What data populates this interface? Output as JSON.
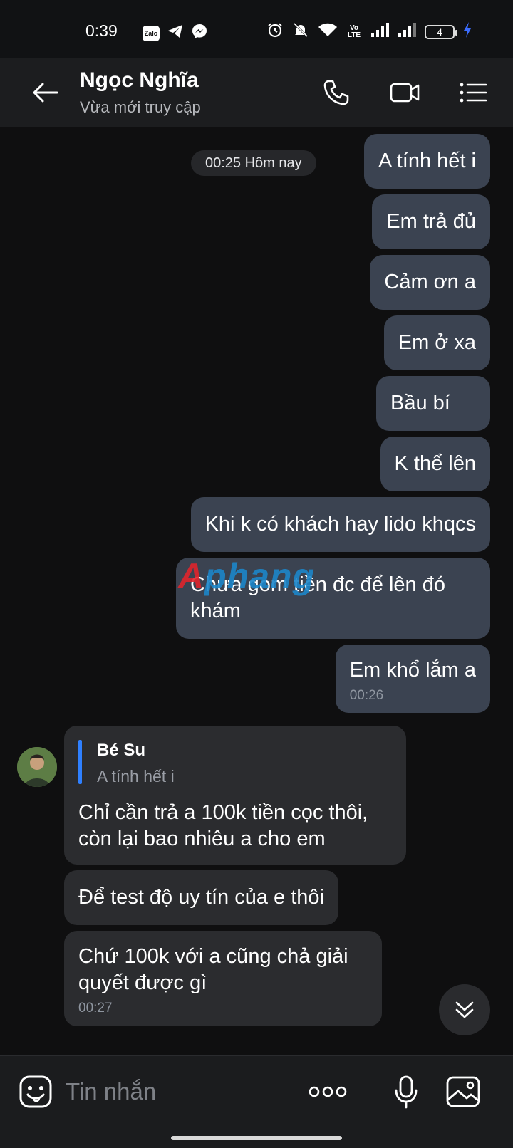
{
  "status_bar": {
    "time": "0:39",
    "app_icons": [
      "zalo-icon",
      "telegram-icon",
      "messenger-icon"
    ],
    "zalo_label": "Zalo",
    "volte_label": "Vo LTE",
    "battery": "4"
  },
  "header": {
    "name": "Ngọc Nghĩa",
    "status": "Vừa mới truy cập"
  },
  "chat": {
    "date_label": "00:25 Hôm nay",
    "outgoing": [
      {
        "text": "A tính hết i"
      },
      {
        "text": "Em trả đủ"
      },
      {
        "text": "Cảm ơn a"
      },
      {
        "text": "Em ở xa"
      },
      {
        "text": "Bầu bí"
      },
      {
        "text": "K thể lên"
      },
      {
        "text": "Khi k có khách hay lido khqcs"
      },
      {
        "text": "Chưa gom tiền đc để lên đó khám"
      },
      {
        "text": "Em khổ lắm a",
        "time": "00:26"
      }
    ],
    "incoming": [
      {
        "quote_name": "Bé Su",
        "quote_text": "A tính hết i",
        "text": "Chỉ cần trả a 100k tiền cọc thôi, còn lại bao nhiêu a cho em"
      },
      {
        "text": "Để test độ uy tín của e thôi"
      },
      {
        "text": "Chứ 100k với a cũng chả giải quyết được gì",
        "time": "00:27"
      }
    ],
    "watermark": "Aphang"
  },
  "input_bar": {
    "placeholder": "Tin nhắn"
  },
  "colors": {
    "outgoing_bubble": "#3b4351",
    "incoming_bubble": "#2b2c2f",
    "quote_bar": "#2f80ff",
    "background": "#0f0f10"
  }
}
